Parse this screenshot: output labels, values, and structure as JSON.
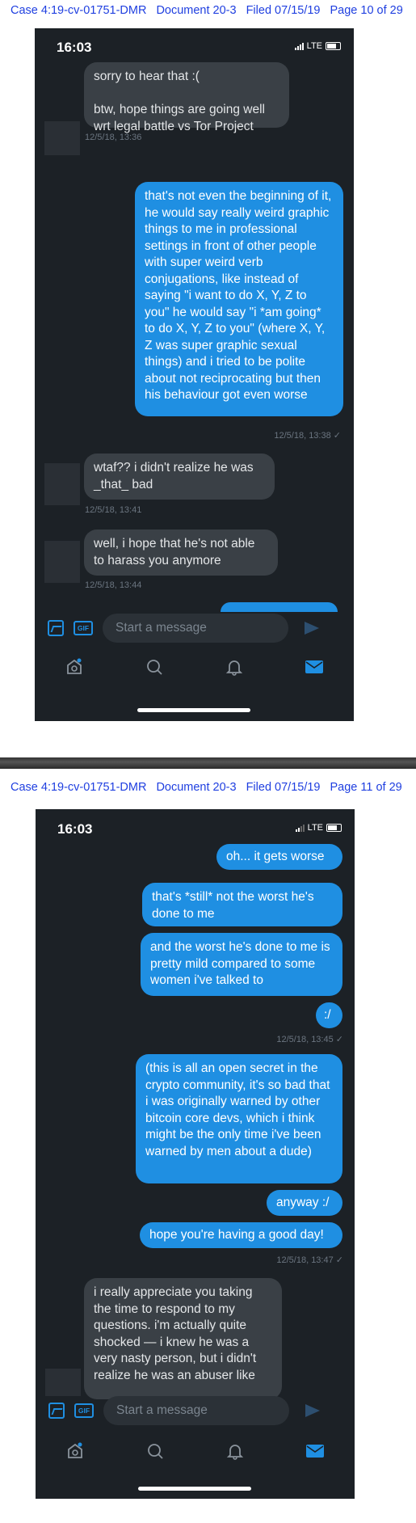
{
  "pages": [
    {
      "header": {
        "case": "Case 4:19-cv-01751-DMR",
        "document": "Document 20-3",
        "filed": "Filed 07/15/19",
        "page": "Page 10 of 29"
      },
      "status": {
        "time": "16:03",
        "network": "LTE"
      },
      "messages": [
        {
          "dir": "in",
          "text": "sorry to hear that :(\n\nbtw, hope things are going well wrt legal battle vs Tor Project",
          "ts": "12/5/18, 13:36"
        },
        {
          "dir": "out",
          "text": "that's not even the beginning of it, he would say really weird graphic things to me in professional settings in front of other people with super weird verb conjugations, like instead of saying \"i want to do X, Y, Z to you\" he would say \"i *am going* to do X, Y, Z to you\" (where X, Y, Z was super graphic sexual things) and i tried to be polite about not reciprocating but then his behaviour got even worse",
          "ts": "12/5/18, 13:38 ✓"
        },
        {
          "dir": "in",
          "text": "wtaf?? i didn't realize he was _that_ bad",
          "ts": "12/5/18, 13:41"
        },
        {
          "dir": "in",
          "text": "well, i hope that he's not able to harass you anymore",
          "ts": "12/5/18, 13:44"
        }
      ],
      "composer": {
        "gif": "GIF",
        "placeholder": "Start a message"
      }
    },
    {
      "header": {
        "case": "Case 4:19-cv-01751-DMR",
        "document": "Document 20-3",
        "filed": "Filed 07/15/19",
        "page": "Page 11 of 29"
      },
      "status": {
        "time": "16:03",
        "network": "LTE"
      },
      "messages": [
        {
          "dir": "out",
          "text": "oh... it gets worse"
        },
        {
          "dir": "out",
          "text": "that's *still* not the worst he's done to me"
        },
        {
          "dir": "out",
          "text": "and the worst he's done to me is pretty mild compared to some women i've talked to"
        },
        {
          "dir": "out",
          "text": ":/",
          "ts": "12/5/18, 13:45 ✓"
        },
        {
          "dir": "out",
          "text": "(this is all an open secret in the crypto community, it's so bad that i was originally warned by other bitcoin core devs, which i think might be the only time i've been warned by men about a dude)"
        },
        {
          "dir": "out",
          "text": "anyway :/"
        },
        {
          "dir": "out",
          "text": "hope you're having a good day!",
          "ts": "12/5/18, 13:47 ✓"
        },
        {
          "dir": "in",
          "text": "i really appreciate you taking the time to respond to my questions. i'm actually quite shocked — i knew he was a very nasty person, but i didn't realize he was an abuser like"
        }
      ],
      "composer": {
        "gif": "GIF",
        "placeholder": "Start a message"
      }
    }
  ],
  "colors": {
    "outgoing": "#1f8fe2",
    "incoming": "#3a4046",
    "background": "#1c2126",
    "header_link": "#1f3fe0"
  },
  "icons": [
    "image-icon",
    "gif-icon",
    "send-icon",
    "home-icon",
    "search-icon",
    "bell-icon",
    "mail-icon"
  ]
}
